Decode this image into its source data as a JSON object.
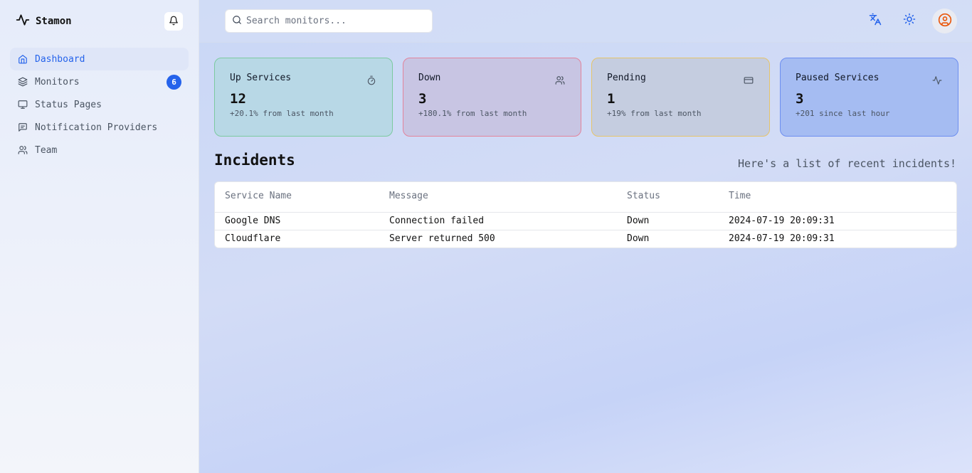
{
  "app": {
    "name": "Stamon"
  },
  "sidebar": {
    "items": [
      {
        "label": "Dashboard",
        "icon": "home-icon",
        "active": true
      },
      {
        "label": "Monitors",
        "icon": "layers-icon",
        "badge": "6"
      },
      {
        "label": "Status Pages",
        "icon": "monitor-icon"
      },
      {
        "label": "Notification Providers",
        "icon": "message-icon"
      },
      {
        "label": "Team",
        "icon": "users-icon"
      }
    ]
  },
  "search": {
    "placeholder": "Search monitors..."
  },
  "cards": [
    {
      "title": "Up Services",
      "value": "12",
      "sub": "+20.1% from last month",
      "icon": "timer-icon"
    },
    {
      "title": "Down",
      "value": "3",
      "sub": "+180.1% from last month",
      "icon": "users-icon"
    },
    {
      "title": "Pending",
      "value": "1",
      "sub": "+19% from last month",
      "icon": "credit-card-icon"
    },
    {
      "title": "Paused Services",
      "value": "3",
      "sub": "+201 since last hour",
      "icon": "activity-icon"
    }
  ],
  "incidents": {
    "title": "Incidents",
    "subtitle": "Here's a list of recent incidents!",
    "columns": [
      "Service Name",
      "Message",
      "Status",
      "Time"
    ],
    "rows": [
      [
        "Google DNS",
        "Connection failed",
        "Down",
        "2024-07-19 20:09:31"
      ],
      [
        "Cloudflare",
        "Server returned 500",
        "Down",
        "2024-07-19 20:09:31"
      ]
    ]
  },
  "colors": {
    "accent": "#2563eb",
    "avatar": "#ea580c"
  }
}
